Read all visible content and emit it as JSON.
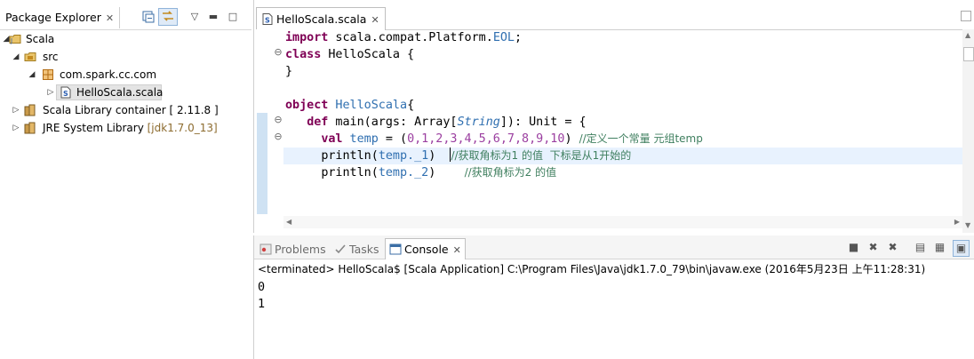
{
  "package_explorer": {
    "tab_label": "Package Explorer",
    "tree": [
      {
        "label": "Scala",
        "level": 0,
        "expanded": true,
        "icon": "project-icon"
      },
      {
        "label": "src",
        "level": 1,
        "expanded": true,
        "icon": "source-folder-icon"
      },
      {
        "label": "com.spark.cc.com",
        "level": 2,
        "expanded": true,
        "icon": "package-icon"
      },
      {
        "label": "HelloScala.scala",
        "level": 3,
        "expanded": false,
        "icon": "scala-file-icon"
      },
      {
        "label": "Scala Library container [ 2.11.8 ]",
        "level": 1,
        "expanded": false,
        "icon": "library-icon"
      },
      {
        "label": "JRE System Library",
        "suffix": "[jdk1.7.0_13]",
        "level": 1,
        "expanded": false,
        "icon": "library-icon"
      }
    ]
  },
  "editor": {
    "tab_label": "HelloScala.scala",
    "lines": {
      "l1_kw": "import",
      "l1_rest": " scala.compat.Platform.",
      "l1_eol": "EOL",
      "l1_end": ";",
      "l2_kw": "class",
      "l2_rest": " HelloScala {",
      "l3": "}",
      "l5_kw": "object",
      "l5_name": " HelloScala",
      "l5_end": "{",
      "l6_indent": "   ",
      "l6_kw": "def",
      "l6_a": " main(args: Array[",
      "l6_type": "String",
      "l6_b": "]): Unit = {",
      "l7_indent": "     ",
      "l7_kw": "val",
      "l7_var": " temp",
      "l7_a": " = (",
      "l7_nums": "0,1,2,3,4,5,6,7,8,9,10",
      "l7_b": ") ",
      "l7_comment": "//定义一个常量 元组temp",
      "l8_indent": "     ",
      "l8_a": "println(",
      "l8_field": "temp._1",
      "l8_b": ")  ",
      "l8_comment": "//获取角标为1 的值  下标是从1开始的",
      "l9_indent": "     ",
      "l9_a": "println(",
      "l9_field": "temp._2",
      "l9_b": ")    ",
      "l9_comment": "//获取角标为2 的值"
    }
  },
  "console_view": {
    "tabs": {
      "problems": "Problems",
      "tasks": "Tasks",
      "console": "Console"
    },
    "status": "<terminated> HelloScala$ [Scala Application] C:\\Program Files\\Java\\jdk1.7.0_79\\bin\\javaw.exe (2016年5月23日 上午11:28:31)",
    "output": [
      "0",
      "1"
    ]
  },
  "colors": {
    "keyword": "#7f0055",
    "type": "#2f6fb0",
    "number": "#9b3fa0",
    "comment": "#3f7f5f",
    "current_line": "#e8f2fe"
  }
}
